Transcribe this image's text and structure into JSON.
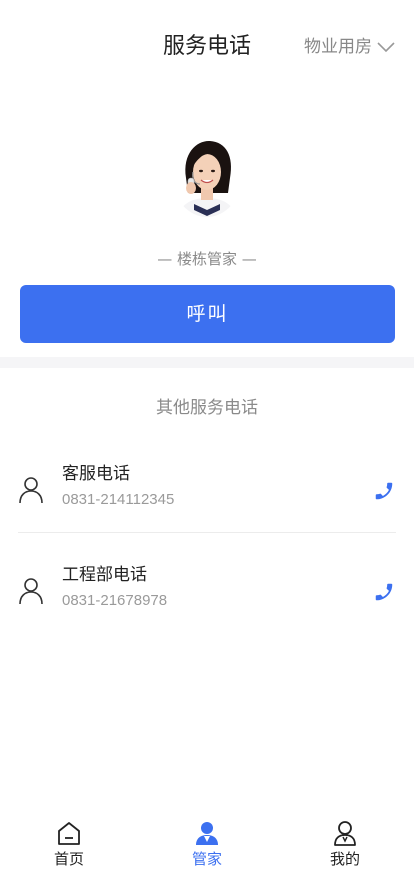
{
  "header": {
    "title": "服务电话",
    "property_selector": "物业用房"
  },
  "manager": {
    "role_label": "— 楼栋管家 —",
    "call_button": "呼叫"
  },
  "other_services": {
    "title": "其他服务电话",
    "items": [
      {
        "name": "客服电话",
        "phone": "0831-214112345"
      },
      {
        "name": "工程部电话",
        "phone": "0831-21678978"
      }
    ]
  },
  "bottom_nav": {
    "items": [
      {
        "label": "首页",
        "icon": "home-icon",
        "active": false
      },
      {
        "label": "管家",
        "icon": "butler-icon",
        "active": true
      },
      {
        "label": "我的",
        "icon": "profile-icon",
        "active": false
      }
    ]
  },
  "colors": {
    "accent": "#3c70f0",
    "text_primary": "#222222",
    "text_secondary": "#8a8a8a",
    "background": "#ffffff",
    "band": "#f5f5f7"
  }
}
